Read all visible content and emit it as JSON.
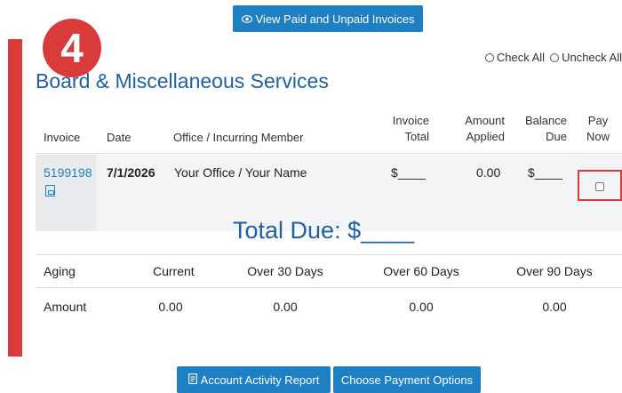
{
  "toolbar": {
    "view_invoices_label": "View Paid and Unpaid Invoices"
  },
  "step": {
    "number": "4"
  },
  "selection": {
    "check_all_label": "Check All",
    "uncheck_all_label": "Uncheck All"
  },
  "section": {
    "title": "Board & Miscellaneous Services"
  },
  "table": {
    "headers": {
      "invoice": "Invoice",
      "date": "Date",
      "office": "Office / Incurring Member",
      "invoice_total_1": "Invoice",
      "invoice_total_2": "Total",
      "amount_applied_1": "Amount",
      "amount_applied_2": "Applied",
      "balance_due_1": "Balance",
      "balance_due_2": "Due",
      "pay_now_1": "Pay",
      "pay_now_2": "Now"
    },
    "rows": [
      {
        "invoice": "5199198",
        "date": "7/1/2026",
        "office": "Your Office / Your Name",
        "invoice_total": "$____",
        "amount_applied": "0.00",
        "balance_due": "$____"
      }
    ]
  },
  "total_due": {
    "label": "Total Due:",
    "value": "$____"
  },
  "aging": {
    "headers": {
      "label": "Aging",
      "current": "Current",
      "over30": "Over 30 Days",
      "over60": "Over 60 Days",
      "over90": "Over 90 Days"
    },
    "amount_label": "Amount",
    "values": {
      "current": "0.00",
      "over30": "0.00",
      "over60": "0.00",
      "over90": "0.00"
    }
  },
  "footer": {
    "activity_report_label": "Account Activity Report",
    "payment_options_label": "Choose Payment Options"
  },
  "icons": {
    "eye": "eye-icon",
    "pdf": "pdf-icon",
    "report": "document-icon"
  },
  "colors": {
    "accent": "#1f7fc3",
    "title": "#1f5fa6",
    "highlight": "#d93a3a"
  }
}
